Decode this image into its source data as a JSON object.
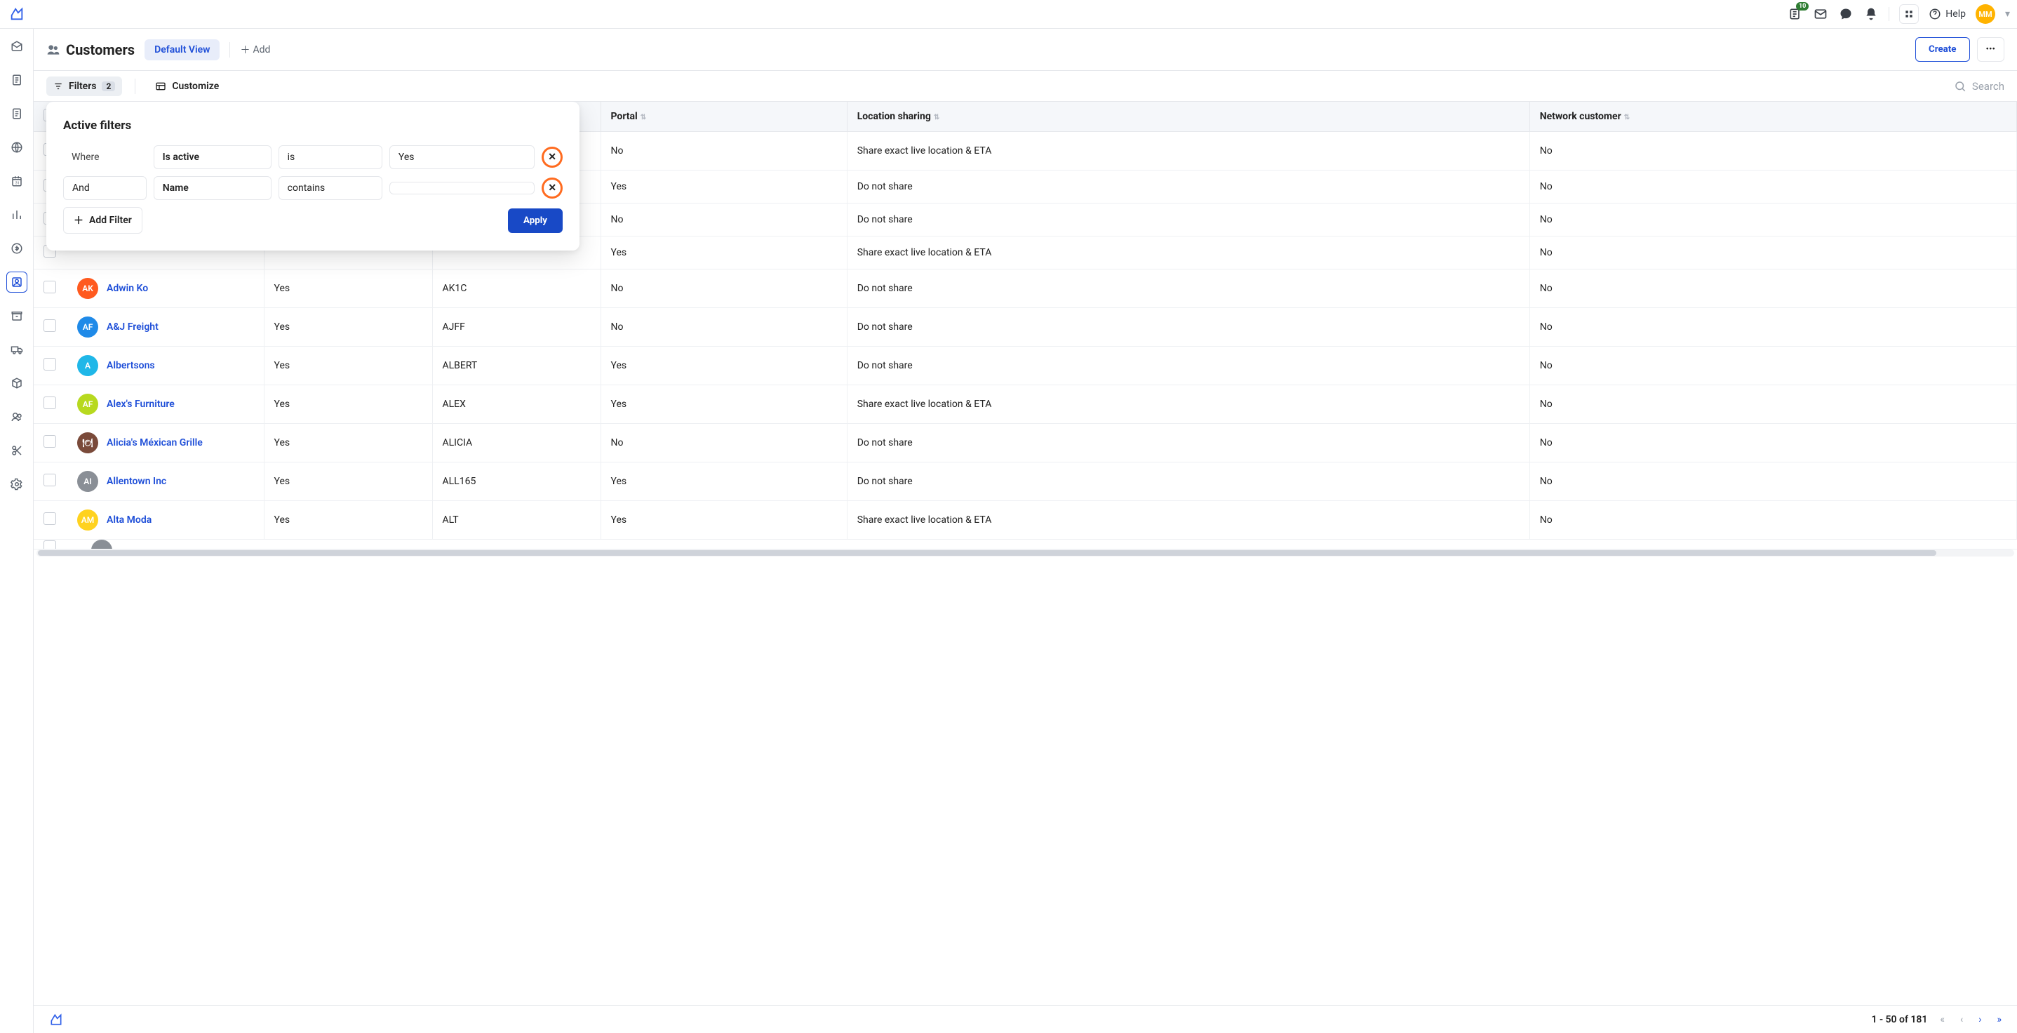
{
  "topbar": {
    "news_badge": "10",
    "help_label": "Help",
    "avatar_initials": "MM"
  },
  "page": {
    "title": "Customers",
    "view_label": "Default View",
    "add_label": "Add",
    "create_label": "Create"
  },
  "toolbar": {
    "filters_label": "Filters",
    "filters_count": "2",
    "customize_label": "Customize",
    "search_placeholder": "Search"
  },
  "filter_popover": {
    "title": "Active filters",
    "where_label": "Where",
    "rows": [
      {
        "logic": "",
        "field": "Is active",
        "op": "is",
        "value": "Yes"
      },
      {
        "logic": "And",
        "field": "Name",
        "op": "contains",
        "value": ""
      }
    ],
    "add_filter_label": "Add Filter",
    "apply_label": "Apply"
  },
  "table": {
    "columns": {
      "portal": "Portal",
      "location_sharing": "Location sharing",
      "network_customer": "Network customer"
    },
    "rows": [
      {
        "name": "",
        "avatar": "",
        "avatar_color": "#1fb07a",
        "active": "",
        "code": "",
        "portal": "No",
        "location": "Share exact live location & ETA",
        "network": "No"
      },
      {
        "name": "",
        "avatar": "",
        "avatar_color": "",
        "active": "",
        "code": "",
        "portal": "Yes",
        "location": "Do not share",
        "network": "No"
      },
      {
        "name": "",
        "avatar": "",
        "avatar_color": "",
        "active": "",
        "code": "",
        "portal": "No",
        "location": "Do not share",
        "network": "No"
      },
      {
        "name": "",
        "avatar": "",
        "avatar_color": "",
        "active": "",
        "code": "",
        "portal": "Yes",
        "location": "Share exact live location & ETA",
        "network": "No"
      },
      {
        "name": "Adwin Ko",
        "avatar": "AK",
        "avatar_color": "#ff5a1f",
        "active": "Yes",
        "code": "AK1C",
        "portal": "No",
        "location": "Do not share",
        "network": "No"
      },
      {
        "name": "A&J Freight",
        "avatar": "AF",
        "avatar_color": "#1f8ae8",
        "active": "Yes",
        "code": "AJFF",
        "portal": "No",
        "location": "Do not share",
        "network": "No"
      },
      {
        "name": "Albertsons",
        "avatar": "A",
        "avatar_color": "#1fb7e8",
        "active": "Yes",
        "code": "ALBERT",
        "portal": "Yes",
        "location": "Do not share",
        "network": "No"
      },
      {
        "name": "Alex's Furniture",
        "avatar": "AF",
        "avatar_color": "#b7d91f",
        "active": "Yes",
        "code": "ALEX",
        "portal": "Yes",
        "location": "Share exact live location & ETA",
        "network": "No"
      },
      {
        "name": "Alicia's Méxican Grille",
        "avatar": "🍽",
        "avatar_color": "#7a4a3a",
        "active": "Yes",
        "code": "ALICIA",
        "portal": "No",
        "location": "Do not share",
        "network": "No"
      },
      {
        "name": "Allentown Inc",
        "avatar": "AI",
        "avatar_color": "#8a8f96",
        "active": "Yes",
        "code": "ALL165",
        "portal": "Yes",
        "location": "Do not share",
        "network": "No"
      },
      {
        "name": "Alta Moda",
        "avatar": "AM",
        "avatar_color": "#ffd21f",
        "active": "Yes",
        "code": "ALT",
        "portal": "Yes",
        "location": "Share exact live location & ETA",
        "network": "No"
      }
    ]
  },
  "footer": {
    "range": "1 - 50 of 181"
  }
}
